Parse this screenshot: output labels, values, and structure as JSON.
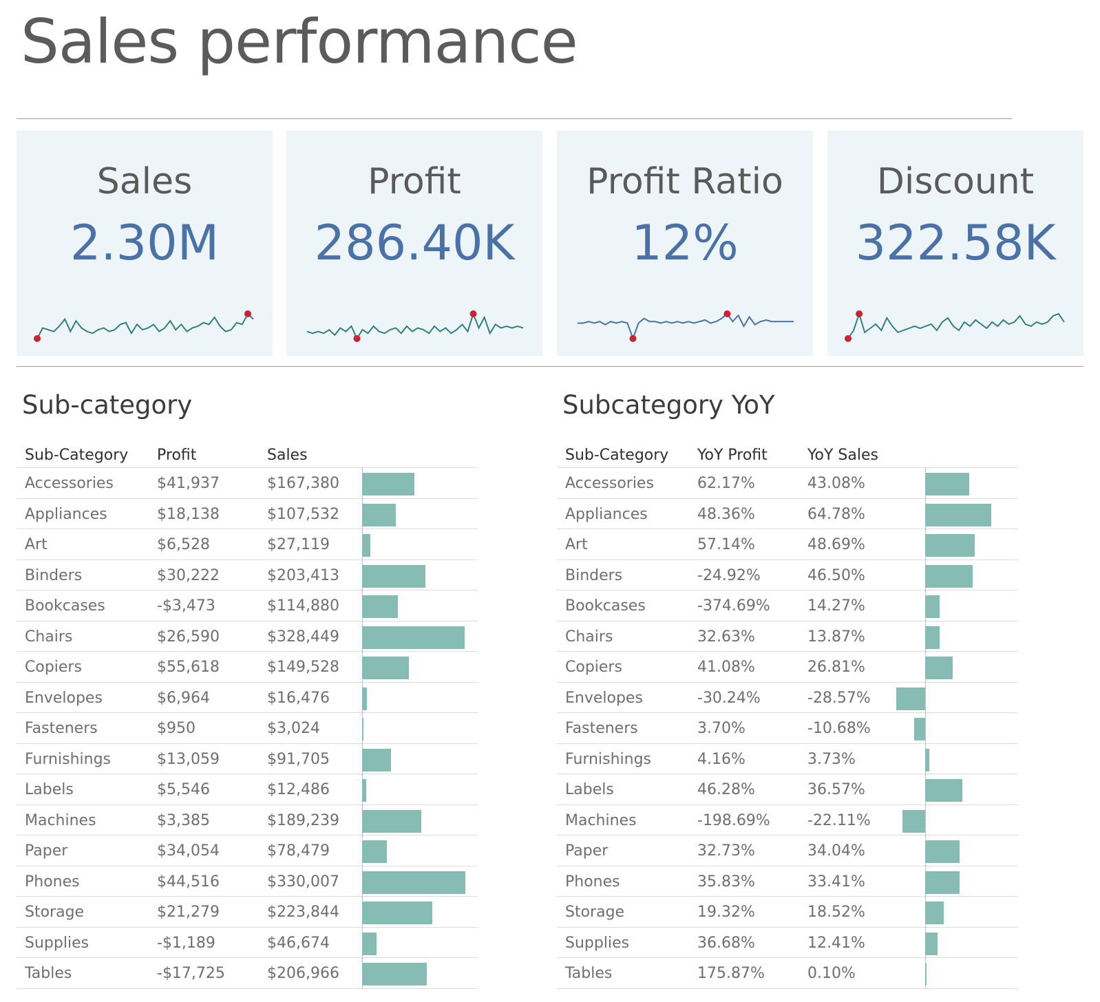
{
  "page_title": "Sales performance",
  "kpis": [
    {
      "label": "Sales",
      "value": "2.30M",
      "line_color": "#2f7f80",
      "sparkline": [
        4,
        10,
        9,
        8,
        11,
        15,
        8,
        14,
        10,
        8,
        7,
        9,
        10,
        8,
        9,
        12,
        13,
        7,
        12,
        9,
        10,
        12,
        8,
        10,
        14,
        9,
        12,
        8,
        10,
        11,
        13,
        12,
        16,
        11,
        8,
        9,
        13,
        12,
        18,
        15
      ],
      "marker_color": "#cc2233"
    },
    {
      "label": "Profit",
      "value": "286.40K",
      "line_color": "#2f7f80",
      "sparkline": [
        10,
        9,
        10,
        9,
        11,
        8,
        12,
        10,
        13,
        6,
        11,
        9,
        13,
        10,
        9,
        11,
        12,
        9,
        13,
        10,
        12,
        11,
        9,
        13,
        10,
        12,
        9,
        11,
        14,
        10,
        20,
        12,
        18,
        9,
        14,
        12,
        13,
        12,
        13,
        12
      ],
      "marker_color": "#cc2233"
    },
    {
      "label": "Profit Ratio",
      "value": "12%",
      "line_color": "#4a72a6",
      "sparkline": [
        14,
        14,
        15,
        14,
        15,
        13,
        15,
        14,
        15,
        14,
        4,
        14,
        17,
        15,
        15,
        14,
        15,
        14,
        15,
        14,
        15,
        14,
        15,
        16,
        14,
        15,
        17,
        20,
        15,
        19,
        12,
        18,
        13,
        15,
        16,
        15,
        15,
        15,
        15,
        15
      ],
      "marker_color": "#cc2233"
    },
    {
      "label": "Discount",
      "value": "322.58K",
      "line_color": "#2f7f80",
      "sparkline": [
        2,
        6,
        14,
        5,
        7,
        9,
        6,
        12,
        8,
        5,
        6,
        7,
        8,
        7,
        8,
        9,
        6,
        10,
        12,
        8,
        6,
        10,
        8,
        11,
        9,
        7,
        10,
        8,
        11,
        9,
        10,
        13,
        9,
        8,
        10,
        9,
        10,
        13,
        14,
        10
      ],
      "marker_color": "#cc2233"
    }
  ],
  "subcategory": {
    "title": "Sub-category",
    "headers": {
      "name": "Sub-Category",
      "profit": "Profit",
      "sales": "Sales"
    },
    "rows": [
      {
        "name": "Accessories",
        "profit": "$41,937",
        "sales": "$167,380",
        "sales_value": 167380
      },
      {
        "name": "Appliances",
        "profit": "$18,138",
        "sales": "$107,532",
        "sales_value": 107532
      },
      {
        "name": "Art",
        "profit": "$6,528",
        "sales": "$27,119",
        "sales_value": 27119
      },
      {
        "name": "Binders",
        "profit": "$30,222",
        "sales": "$203,413",
        "sales_value": 203413
      },
      {
        "name": "Bookcases",
        "profit": "-$3,473",
        "sales": "$114,880",
        "sales_value": 114880
      },
      {
        "name": "Chairs",
        "profit": "$26,590",
        "sales": "$328,449",
        "sales_value": 328449
      },
      {
        "name": "Copiers",
        "profit": "$55,618",
        "sales": "$149,528",
        "sales_value": 149528
      },
      {
        "name": "Envelopes",
        "profit": "$6,964",
        "sales": "$16,476",
        "sales_value": 16476
      },
      {
        "name": "Fasteners",
        "profit": "$950",
        "sales": "$3,024",
        "sales_value": 3024
      },
      {
        "name": "Furnishings",
        "profit": "$13,059",
        "sales": "$91,705",
        "sales_value": 91705
      },
      {
        "name": "Labels",
        "profit": "$5,546",
        "sales": "$12,486",
        "sales_value": 12486
      },
      {
        "name": "Machines",
        "profit": "$3,385",
        "sales": "$189,239",
        "sales_value": 189239
      },
      {
        "name": "Paper",
        "profit": "$34,054",
        "sales": "$78,479",
        "sales_value": 78479
      },
      {
        "name": "Phones",
        "profit": "$44,516",
        "sales": "$330,007",
        "sales_value": 330007
      },
      {
        "name": "Storage",
        "profit": "$21,279",
        "sales": "$223,844",
        "sales_value": 223844
      },
      {
        "name": "Supplies",
        "profit": "-$1,189",
        "sales": "$46,674",
        "sales_value": 46674
      },
      {
        "name": "Tables",
        "profit": "-$17,725",
        "sales": "$206,966",
        "sales_value": 206966
      }
    ]
  },
  "yoy": {
    "title": "Subcategory YoY",
    "headers": {
      "name": "Sub-Category",
      "profit": "YoY Profit",
      "sales": "YoY Sales"
    },
    "rows": [
      {
        "name": "Accessories",
        "profit": "62.17%",
        "sales": "43.08%",
        "sales_value": 43.08
      },
      {
        "name": "Appliances",
        "profit": "48.36%",
        "sales": "64.78%",
        "sales_value": 64.78
      },
      {
        "name": "Art",
        "profit": "57.14%",
        "sales": "48.69%",
        "sales_value": 48.69
      },
      {
        "name": "Binders",
        "profit": "-24.92%",
        "sales": "46.50%",
        "sales_value": 46.5
      },
      {
        "name": "Bookcases",
        "profit": "-374.69%",
        "sales": "14.27%",
        "sales_value": 14.27
      },
      {
        "name": "Chairs",
        "profit": "32.63%",
        "sales": "13.87%",
        "sales_value": 13.87
      },
      {
        "name": "Copiers",
        "profit": "41.08%",
        "sales": "26.81%",
        "sales_value": 26.81
      },
      {
        "name": "Envelopes",
        "profit": "-30.24%",
        "sales": "-28.57%",
        "sales_value": -28.57
      },
      {
        "name": "Fasteners",
        "profit": "3.70%",
        "sales": "-10.68%",
        "sales_value": -10.68
      },
      {
        "name": "Furnishings",
        "profit": "4.16%",
        "sales": "3.73%",
        "sales_value": 3.73
      },
      {
        "name": "Labels",
        "profit": "46.28%",
        "sales": "36.57%",
        "sales_value": 36.57
      },
      {
        "name": "Machines",
        "profit": "-198.69%",
        "sales": "-22.11%",
        "sales_value": -22.11
      },
      {
        "name": "Paper",
        "profit": "32.73%",
        "sales": "34.04%",
        "sales_value": 34.04
      },
      {
        "name": "Phones",
        "profit": "35.83%",
        "sales": "33.41%",
        "sales_value": 33.41
      },
      {
        "name": "Storage",
        "profit": "19.32%",
        "sales": "18.52%",
        "sales_value": 18.52
      },
      {
        "name": "Supplies",
        "profit": "36.68%",
        "sales": "12.41%",
        "sales_value": 12.41
      },
      {
        "name": "Tables",
        "profit": "175.87%",
        "sales": "0.10%",
        "sales_value": 0.1
      }
    ]
  },
  "bar_color": "#86bcb3"
}
